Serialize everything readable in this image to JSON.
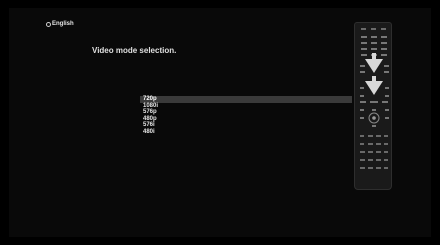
{
  "header": {
    "language": "English"
  },
  "screen": {
    "title": "Video mode selection."
  },
  "video_modes": {
    "selected_index": 0,
    "options": [
      "720p",
      "1080i",
      "576p",
      "480p",
      "576i",
      "480i"
    ]
  },
  "icons": {
    "language": "globe-icon",
    "remote": "remote-control-icon"
  },
  "colors": {
    "background": "#000000",
    "selection": "#3a3a3a",
    "text": "#e6e6e6"
  }
}
